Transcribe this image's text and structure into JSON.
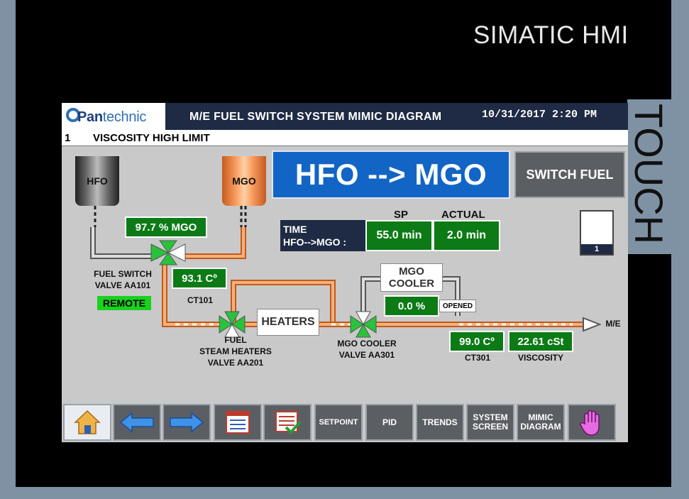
{
  "device": {
    "brand": "SIMATIC HMI",
    "touch_label": "TOUCH"
  },
  "header": {
    "logo_text_1": "Pan",
    "logo_text_2": "technic",
    "title": "M/E FUEL SWITCH SYSTEM MIMIC DIAGRAM",
    "datetime": "10/31/2017 2:20 PM"
  },
  "alarm": {
    "number": "1",
    "text": "VISCOSITY HIGH LIMIT"
  },
  "tanks": {
    "hfo": "HFO",
    "mgo": "MGO"
  },
  "status_banner": "HFO --> MGO",
  "switch_button": "SWITCH FUEL",
  "fuel_mix": "97.7 % MGO",
  "ct101": {
    "value": "93.1 Cº",
    "label": "CT101"
  },
  "fuel_switch_valve_label": "FUEL SWITCH\nVALVE AA101",
  "remote": "REMOTE",
  "timer": {
    "label": "TIME\nHFO-->MGO :",
    "sp_header": "SP",
    "actual_header": "ACTUAL",
    "sp": "55.0 min",
    "actual": "2.0 min"
  },
  "warning": {
    "count": "1"
  },
  "mgo_cooler": {
    "label": "MGO\nCOOLER",
    "percent": "0.0 %",
    "state": "OPENED",
    "valve_label": "MGO COOLER\nVALVE AA301"
  },
  "heaters": {
    "label": "HEATERS",
    "valve_label": "FUEL\nSTEAM HEATERS\nVALVE AA201"
  },
  "outlet": "M/E",
  "ct301": {
    "value": "99.0 Cº",
    "label": "CT301"
  },
  "viscosity": {
    "value": "22.61 cSt",
    "label": "VISCOSITY"
  },
  "toolbar": {
    "setpoint": "SETPOINT",
    "pid": "PID",
    "trends": "TRENDS",
    "system_screen": "SYSTEM\nSCREEN",
    "mimic_diagram": "MIMIC\nDIAGRAM"
  },
  "colors": {
    "value_green": "#0c7b16",
    "accent_blue": "#1265c5",
    "title_navy": "#1f2a44",
    "pipe_orange": "#f4a46a",
    "remote_green": "#18d21e"
  }
}
